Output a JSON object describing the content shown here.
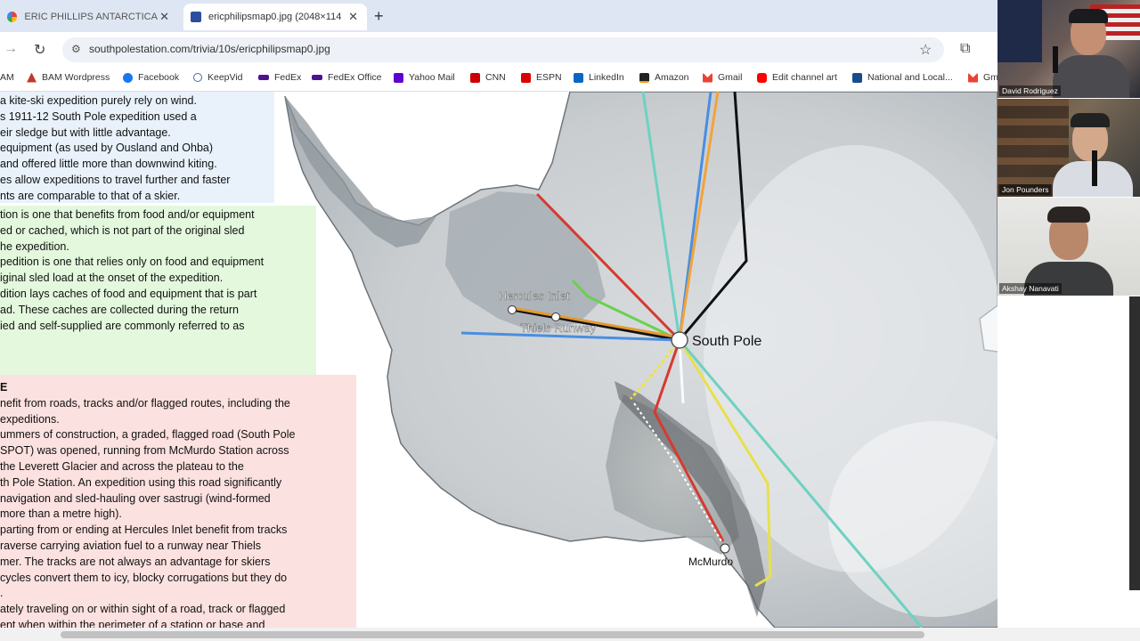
{
  "tabs": [
    {
      "title": "ERIC PHILLIPS ANTARCTICA SO",
      "close": "✕"
    },
    {
      "title": "ericphilipsmap0.jpg (2048×114",
      "close": "✕"
    }
  ],
  "new_tab": "+",
  "toolbar": {
    "forward": "→",
    "reload": "↻",
    "site_info": "⚙",
    "url": "southpolestation.com/trivia/10s/ericphilipsmap0.jpg",
    "star": "☆",
    "extensions": "⧉"
  },
  "bookmarks": [
    {
      "label": "AM",
      "color": "#c0392b"
    },
    {
      "label": "BAM Wordpress",
      "color": "#c0392b"
    },
    {
      "label": "Facebook",
      "color": "#1877f2"
    },
    {
      "label": "KeepVid",
      "color": "#3a6fb0"
    },
    {
      "label": "FedEx",
      "color": "#4d148c"
    },
    {
      "label": "FedEx Office",
      "color": "#4d148c"
    },
    {
      "label": "Yahoo Mail",
      "color": "#6001d2"
    },
    {
      "label": "CNN",
      "color": "#cc0000"
    },
    {
      "label": "ESPN",
      "color": "#d00"
    },
    {
      "label": "LinkedIn",
      "color": "#0a66c2"
    },
    {
      "label": "Amazon",
      "color": "#ff9900"
    },
    {
      "label": "Gmail",
      "color": "#ea4335"
    },
    {
      "label": "Edit channel art",
      "color": "#ff0000"
    },
    {
      "label": "National and Local...",
      "color": "#1a4b8c"
    },
    {
      "label": "Gm",
      "color": "#ea4335"
    }
  ],
  "info_blue": [
    "a kite-ski expedition purely rely on wind.",
    "s 1911-12 South Pole expedition used a",
    "eir sledge but with little advantage.",
    "equipment (as used by Ousland and Ohba)",
    "and offered little more than downwind kiting.",
    "es allow expeditions to travel further and faster",
    "nts are comparable to that of a skier."
  ],
  "info_green": [
    "",
    "tion is one that benefits from food and/or equipment",
    "ed or cached, which is not part of the original sled",
    "he expedition.",
    "pedition is one that relies only on food and equipment",
    "iginal sled load at the onset of the expedition.",
    "dition lays caches of food and equipment that is part",
    "ad. These caches are collected during the return",
    "ied and self-supplied are commonly referred to as"
  ],
  "info_red": [
    "E",
    "nefit from roads, tracks and/or flagged routes, including the",
    " expeditions.",
    "ummers of construction, a graded, flagged road (South Pole",
    "SPOT) was opened, running from McMurdo Station across",
    " the Leverett Glacier and across the plateau to the",
    "th Pole Station. An expedition using this road significantly",
    "navigation and sled-hauling over sastrugi (wind-formed",
    "more than a metre high).",
    "parting from or ending at Hercules Inlet benefit from tracks",
    "raverse carrying aviation fuel to a runway near Thiels",
    "mer. The tracks are not always an advantage for skiers",
    " cycles convert them to icy, blocky corrugations but they do",
    ".",
    "ately traveling on or within sight of a road, track or flagged",
    "ent when within the perimeter of a station or base and"
  ],
  "map": {
    "south_pole": "South Pole",
    "hercules_inlet": "Hercules Inlet",
    "thiels_runway": "Thiels Runway",
    "mcmurdo": "McMurdo"
  },
  "participants": [
    {
      "name": "David Rodriguez"
    },
    {
      "name": "Jon Pounders"
    },
    {
      "name": "Akshay Nanavati"
    }
  ]
}
